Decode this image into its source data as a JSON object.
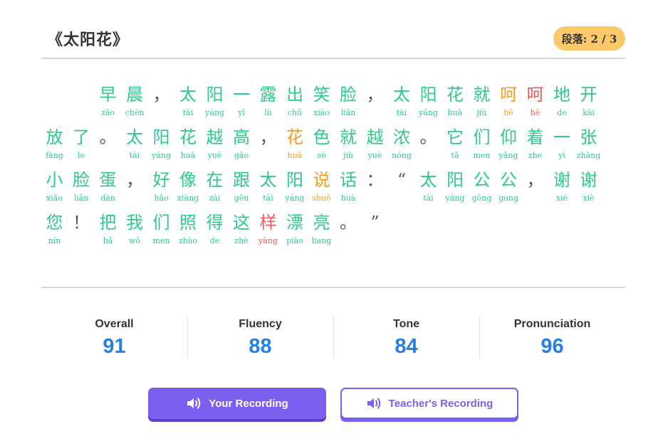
{
  "title": "《太阳花》",
  "paragraph_badge": "段落: 2 / 3",
  "colors": {
    "correct": "#2fc98a",
    "minor_error": "#f39c1f",
    "error": "#ef5a5a",
    "punctuation": "#555555",
    "accent": "#7c5ff0",
    "score": "#2a7ee0"
  },
  "passage": {
    "lines": [
      [
        {
          "c": "",
          "p": "",
          "s": "g"
        },
        {
          "c": "",
          "p": "",
          "s": "g"
        },
        {
          "c": "早",
          "p": "zǎo",
          "s": "g"
        },
        {
          "c": "晨",
          "p": "chén",
          "s": "g"
        },
        {
          "c": "，",
          "p": "",
          "s": "k"
        },
        {
          "c": "太",
          "p": "tài",
          "s": "g"
        },
        {
          "c": "阳",
          "p": "yáng",
          "s": "g"
        },
        {
          "c": "一",
          "p": "yī",
          "s": "g"
        },
        {
          "c": "露",
          "p": "lù",
          "s": "g"
        },
        {
          "c": "出",
          "p": "chū",
          "s": "g"
        },
        {
          "c": "笑",
          "p": "xiào",
          "s": "g"
        },
        {
          "c": "脸",
          "p": "liǎn",
          "s": "g"
        },
        {
          "c": "，",
          "p": "",
          "s": "k"
        },
        {
          "c": "太",
          "p": "tài",
          "s": "g"
        },
        {
          "c": "阳",
          "p": "yáng",
          "s": "g"
        },
        {
          "c": "花",
          "p": "huā",
          "s": "g"
        },
        {
          "c": "就",
          "p": "jiù",
          "s": "g"
        },
        {
          "c": "呵",
          "p": "hē",
          "s": "o"
        },
        {
          "c": "呵",
          "p": "hē",
          "s": "r"
        },
        {
          "c": "地",
          "p": "de",
          "s": "g"
        },
        {
          "c": "开",
          "p": "kāi",
          "s": "g"
        }
      ],
      [
        {
          "c": "放",
          "p": "fàng",
          "s": "g"
        },
        {
          "c": "了",
          "p": "le",
          "s": "g"
        },
        {
          "c": "。",
          "p": "",
          "s": "k"
        },
        {
          "c": "太",
          "p": "tài",
          "s": "g"
        },
        {
          "c": "阳",
          "p": "yáng",
          "s": "g"
        },
        {
          "c": "花",
          "p": "huā",
          "s": "g"
        },
        {
          "c": "越",
          "p": "yuè",
          "s": "g"
        },
        {
          "c": "高",
          "p": "gāo",
          "s": "g"
        },
        {
          "c": "，",
          "p": "",
          "s": "k"
        },
        {
          "c": "花",
          "p": "huā",
          "s": "o"
        },
        {
          "c": "色",
          "p": "sè",
          "s": "g"
        },
        {
          "c": "就",
          "p": "jiù",
          "s": "g"
        },
        {
          "c": "越",
          "p": "yuè",
          "s": "g"
        },
        {
          "c": "浓",
          "p": "nóng",
          "s": "g"
        },
        {
          "c": "。",
          "p": "",
          "s": "k"
        },
        {
          "c": "它",
          "p": "tā",
          "s": "g"
        },
        {
          "c": "们",
          "p": "men",
          "s": "g"
        },
        {
          "c": "仰",
          "p": "yǎng",
          "s": "g"
        },
        {
          "c": "着",
          "p": "zhe",
          "s": "g"
        },
        {
          "c": "一",
          "p": "yì",
          "s": "g"
        },
        {
          "c": "张",
          "p": "zhāng",
          "s": "g"
        }
      ],
      [
        {
          "c": "小",
          "p": "xiǎo",
          "s": "g"
        },
        {
          "c": "脸",
          "p": "liǎn",
          "s": "g"
        },
        {
          "c": "蛋",
          "p": "dàn",
          "s": "g"
        },
        {
          "c": "，",
          "p": "",
          "s": "k"
        },
        {
          "c": "好",
          "p": "hǎo",
          "s": "g"
        },
        {
          "c": "像",
          "p": "xiàng",
          "s": "g"
        },
        {
          "c": "在",
          "p": "zài",
          "s": "g"
        },
        {
          "c": "跟",
          "p": "gēn",
          "s": "g"
        },
        {
          "c": "太",
          "p": "tài",
          "s": "g"
        },
        {
          "c": "阳",
          "p": "yáng",
          "s": "g"
        },
        {
          "c": "说",
          "p": "shuō",
          "s": "o"
        },
        {
          "c": "话",
          "p": "huà",
          "s": "g"
        },
        {
          "c": "：",
          "p": "",
          "s": "k"
        },
        {
          "c": "“",
          "p": "",
          "s": "k"
        },
        {
          "c": "太",
          "p": "tài",
          "s": "g"
        },
        {
          "c": "阳",
          "p": "yáng",
          "s": "g"
        },
        {
          "c": "公",
          "p": "gōng",
          "s": "g"
        },
        {
          "c": "公",
          "p": "gong",
          "s": "g"
        },
        {
          "c": "，",
          "p": "",
          "s": "k"
        },
        {
          "c": "谢",
          "p": "xiè",
          "s": "g"
        },
        {
          "c": "谢",
          "p": "xiè",
          "s": "g"
        }
      ],
      [
        {
          "c": "您",
          "p": "nín",
          "s": "g"
        },
        {
          "c": "！",
          "p": "",
          "s": "k"
        },
        {
          "c": "把",
          "p": "bǎ",
          "s": "g"
        },
        {
          "c": "我",
          "p": "wǒ",
          "s": "g"
        },
        {
          "c": "们",
          "p": "men",
          "s": "g"
        },
        {
          "c": "照",
          "p": "zhào",
          "s": "g"
        },
        {
          "c": "得",
          "p": "de",
          "s": "g"
        },
        {
          "c": "这",
          "p": "zhè",
          "s": "g"
        },
        {
          "c": "样",
          "p": "yàng",
          "s": "r"
        },
        {
          "c": "漂",
          "p": "piào",
          "s": "g"
        },
        {
          "c": "亮",
          "p": "liang",
          "s": "g"
        },
        {
          "c": "。",
          "p": "",
          "s": "k"
        },
        {
          "c": "”",
          "p": "",
          "s": "k"
        }
      ]
    ]
  },
  "scores": [
    {
      "label": "Overall",
      "value": "91"
    },
    {
      "label": "Fluency",
      "value": "88"
    },
    {
      "label": "Tone",
      "value": "84"
    },
    {
      "label": "Pronunciation",
      "value": "96"
    }
  ],
  "buttons": {
    "your_recording": "Your Recording",
    "teacher_recording": "Teacher's Recording",
    "icon": "speaker-icon"
  }
}
